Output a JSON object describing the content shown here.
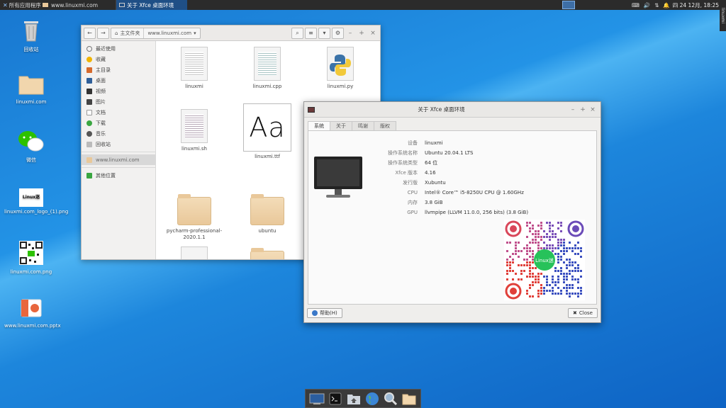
{
  "top_panel": {
    "apps_menu": "所有应用程序",
    "task_web": "www.linuxmi.com",
    "task_about": "关于 Xfce 桌面环境",
    "clock": "四 24 12月, 18:25",
    "side_handle": "linuxmi"
  },
  "desktop": {
    "icons": [
      {
        "label": "回收站"
      },
      {
        "label": "linuxmi.com"
      },
      {
        "label": "微信"
      },
      {
        "label": "linuxmi.com_logo_(1).png"
      },
      {
        "label": "linuxmi.com.png"
      },
      {
        "label": "www.linuxmi.com.pptx"
      }
    ],
    "logo_text": "Linux迷"
  },
  "file_manager": {
    "path": [
      "主文件夹",
      "www.linuxmi.com"
    ],
    "sidebar": [
      {
        "label": "最近使用",
        "icon": "clock-icon"
      },
      {
        "label": "收藏",
        "icon": "star-icon"
      },
      {
        "label": "主目录",
        "icon": "home-icon"
      },
      {
        "label": "桌面",
        "icon": "desktop-icon"
      },
      {
        "label": "视频",
        "icon": "video-icon"
      },
      {
        "label": "图片",
        "icon": "picture-icon"
      },
      {
        "label": "文档",
        "icon": "document-icon"
      },
      {
        "label": "下载",
        "icon": "download-icon"
      },
      {
        "label": "音乐",
        "icon": "music-icon"
      },
      {
        "label": "回收站",
        "icon": "trash-icon"
      }
    ],
    "sidebar_selected": "www.linuxmi.com",
    "sidebar_other": "其他位置",
    "files": [
      {
        "name": "linuxmi",
        "type": "text"
      },
      {
        "name": "linuxmi.cpp",
        "type": "code"
      },
      {
        "name": "linuxmi.py",
        "type": "python"
      },
      {
        "name": "linuxmi.sh",
        "type": "code"
      },
      {
        "name": "linuxmi.ttf",
        "type": "font"
      },
      {
        "name": "pycharm-professional-2020.1.1",
        "type": "folder"
      },
      {
        "name": "ubuntu",
        "type": "folder"
      }
    ],
    "font_preview": "Aa"
  },
  "about": {
    "title": "关于 Xfce 桌面环境",
    "tabs": [
      "系统",
      "关于",
      "鸣谢",
      "版权"
    ],
    "active_tab": "系统",
    "rows": [
      {
        "k": "设备",
        "v": "linuxmi"
      },
      {
        "k": "操作系统名称",
        "v": "Ubuntu 20.04.1 LTS"
      },
      {
        "k": "操作系统类型",
        "v": "64 位"
      },
      {
        "k": "Xfce 版本",
        "v": "4.16"
      },
      {
        "k": "发行版",
        "v": "Xubuntu"
      },
      {
        "k": "CPU",
        "v": "Intel® Core™ i5-8250U CPU @ 1.60GHz"
      },
      {
        "k": "内存",
        "v": "3.8 GiB"
      },
      {
        "k": "GPU",
        "v": "llvmpipe (LLVM 11.0.0, 256 bits) (3.8 GiB)"
      }
    ],
    "qr_logo": "Linux迷",
    "help_label": "帮助(H)",
    "close_label": "Close"
  }
}
